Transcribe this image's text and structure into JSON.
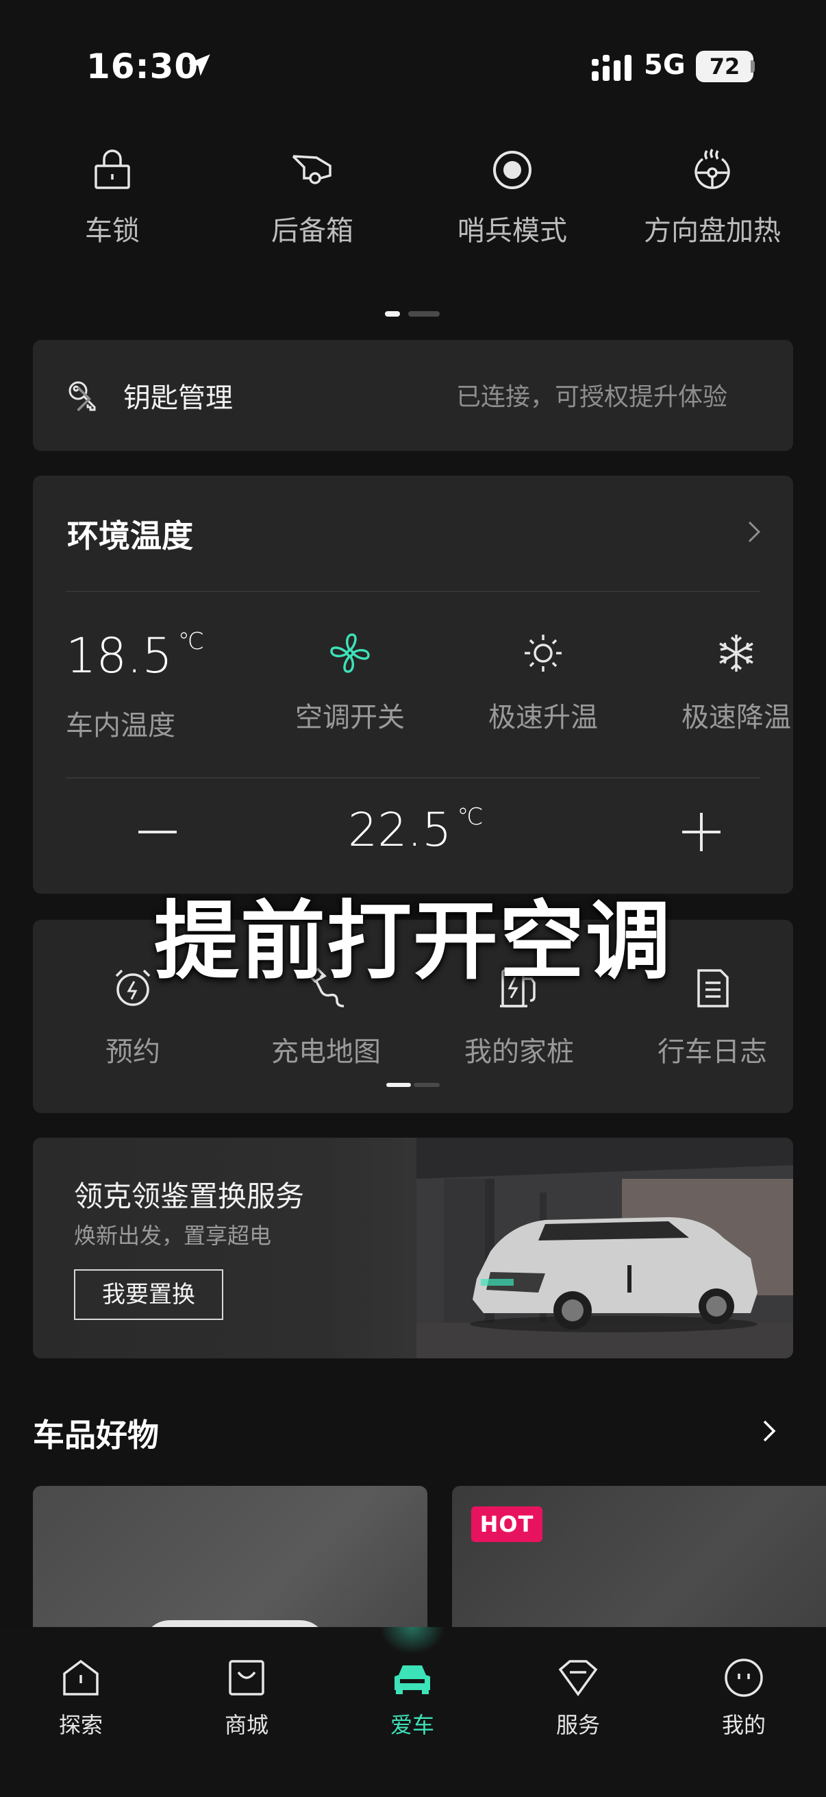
{
  "status_bar": {
    "time": "16:30",
    "network": "5G",
    "battery": "72"
  },
  "quick_controls": [
    {
      "label": "车锁",
      "icon": "lock-icon"
    },
    {
      "label": "后备箱",
      "icon": "trunk-icon"
    },
    {
      "label": "哨兵模式",
      "icon": "sentry-icon"
    },
    {
      "label": "方向盘加热",
      "icon": "steering-heat-icon"
    }
  ],
  "key_card": {
    "title": "钥匙管理",
    "status": "已连接，可授权提升体验"
  },
  "climate": {
    "title": "环境温度",
    "inside_temp": "18.5",
    "unit": "℃",
    "inside_label": "车内温度",
    "ac_label": "空调开关",
    "heat_label": "极速升温",
    "cool_label": "极速降温",
    "set_temp": "22.5",
    "accent": "#3de2b8"
  },
  "caption": "提前打开空调",
  "tools": [
    {
      "label": "预约",
      "icon": "alarm-icon"
    },
    {
      "label": "充电地图",
      "icon": "charge-map-icon"
    },
    {
      "label": "我的家桩",
      "icon": "home-charger-icon"
    },
    {
      "label": "行车日志",
      "icon": "log-icon"
    }
  ],
  "banner": {
    "title": "领克领鉴置换服务",
    "subtitle": "焕新出发，置享超电",
    "button": "我要置换"
  },
  "products": {
    "title": "车品好物",
    "badge": "HOT",
    "badge_color": "#e8135f"
  },
  "tabbar": {
    "active": "爱车",
    "items": [
      {
        "label": "探索",
        "icon": "explore-icon"
      },
      {
        "label": "商城",
        "icon": "shop-icon"
      },
      {
        "label": "爱车",
        "icon": "car-icon"
      },
      {
        "label": "服务",
        "icon": "service-icon"
      },
      {
        "label": "我的",
        "icon": "profile-icon"
      }
    ]
  }
}
